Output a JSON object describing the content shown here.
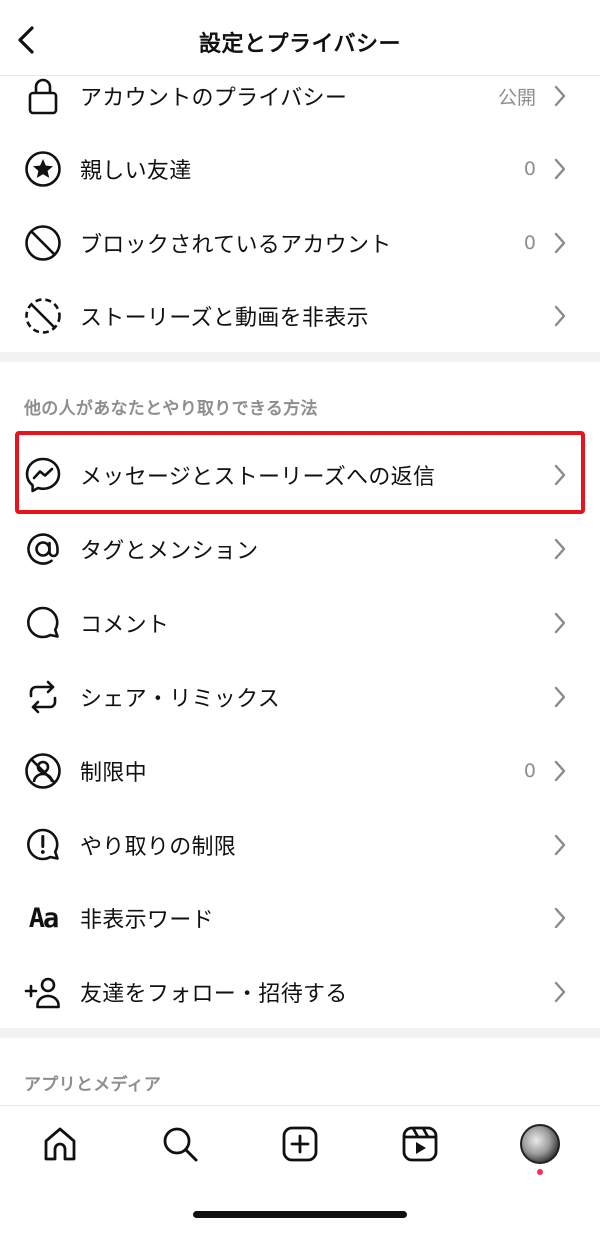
{
  "header": {
    "title": "設定とプライバシー"
  },
  "rows_top": [
    {
      "icon": "lock-icon",
      "label": "アカウントのプライバシー",
      "value": "公開"
    },
    {
      "icon": "close-friends-star-icon",
      "label": "親しい友達",
      "value": "0"
    },
    {
      "icon": "block-icon",
      "label": "ブロックされているアカウント",
      "value": "0"
    },
    {
      "icon": "hide-story-icon",
      "label": "ストーリーズと動画を非表示",
      "value": ""
    }
  ],
  "section_interactions": {
    "title": "他の人があなたとやり取りできる方法"
  },
  "rows_interactions": [
    {
      "icon": "messenger-icon",
      "label": "メッセージとストーリーズへの返信",
      "value": ""
    },
    {
      "icon": "at-sign-icon",
      "label": "タグとメンション",
      "value": ""
    },
    {
      "icon": "comment-icon",
      "label": "コメント",
      "value": ""
    },
    {
      "icon": "share-remix-icon",
      "label": "シェア・リミックス",
      "value": ""
    },
    {
      "icon": "restricted-icon",
      "label": "制限中",
      "value": "0"
    },
    {
      "icon": "limits-icon",
      "label": "やり取りの制限",
      "value": ""
    },
    {
      "icon": "hidden-words-icon",
      "label": "非表示ワード",
      "value": ""
    },
    {
      "icon": "add-friend-icon",
      "label": "友達をフォロー・招待する",
      "value": ""
    }
  ],
  "section_app_media": {
    "title": "アプリとメディア"
  },
  "hidden_words_glyph": "Aa",
  "colors": {
    "highlight": "#e8141b",
    "secondary_text": "#8e8e8e",
    "notify": "#ff2d55"
  },
  "tabbar": {
    "items": [
      {
        "icon": "home-icon"
      },
      {
        "icon": "search-icon"
      },
      {
        "icon": "create-post-icon"
      },
      {
        "icon": "reels-icon"
      },
      {
        "icon": "profile-avatar"
      }
    ]
  }
}
